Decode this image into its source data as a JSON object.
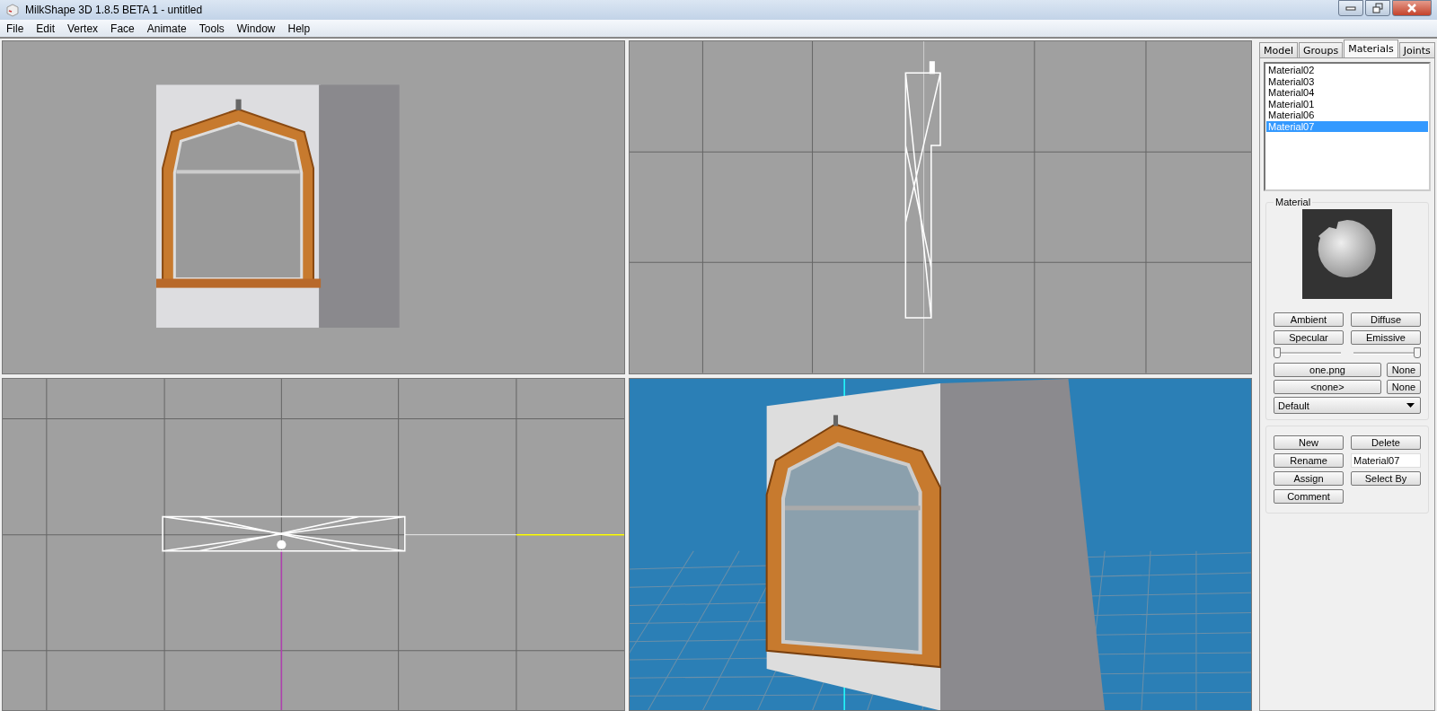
{
  "window": {
    "title": "MilkShape 3D 1.8.5 BETA 1 - untitled"
  },
  "menu": [
    "File",
    "Edit",
    "Vertex",
    "Face",
    "Animate",
    "Tools",
    "Window",
    "Help"
  ],
  "tabs": [
    {
      "label": "Model",
      "selected": false
    },
    {
      "label": "Groups",
      "selected": false
    },
    {
      "label": "Materials",
      "selected": true
    },
    {
      "label": "Joints",
      "selected": false
    }
  ],
  "materials": [
    {
      "name": "Material02",
      "selected": false
    },
    {
      "name": "Material03",
      "selected": false
    },
    {
      "name": "Material04",
      "selected": false
    },
    {
      "name": "Material01",
      "selected": false
    },
    {
      "name": "Material06",
      "selected": false
    },
    {
      "name": "Material07",
      "selected": true
    }
  ],
  "material_group": {
    "title": "Material",
    "color_buttons": [
      "Ambient",
      "Diffuse",
      "Specular",
      "Emissive"
    ],
    "sliders": [
      {
        "level": 0
      },
      {
        "level": 1
      }
    ],
    "textures": [
      {
        "label": "one.png",
        "clear": "None"
      },
      {
        "label": "<none>",
        "clear": "None"
      }
    ],
    "mode": "Default"
  },
  "actions": {
    "new": "New",
    "delete": "Delete",
    "rename": "Rename",
    "name_value": "Material07",
    "assign": "Assign",
    "select_by": "Select By",
    "comment": "Comment"
  }
}
